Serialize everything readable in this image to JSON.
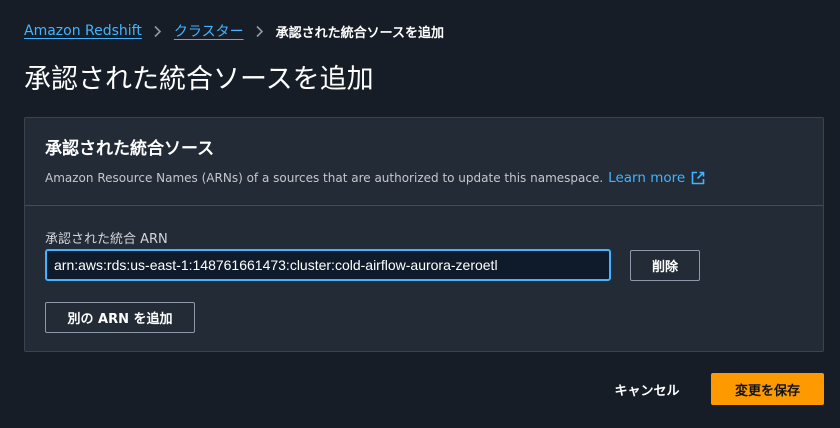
{
  "breadcrumb": {
    "items": [
      {
        "label": "Amazon Redshift"
      },
      {
        "label": "クラスター"
      },
      {
        "label": "承認された統合ソースを追加"
      }
    ]
  },
  "page": {
    "title": "承認された統合ソースを追加"
  },
  "panel": {
    "title": "承認された統合ソース",
    "description": "Amazon Resource Names (ARNs) of a sources that are authorized to update this namespace.",
    "learn_more": "Learn more",
    "field_label": "承認された統合 ARN",
    "arn_value": "arn:aws:rds:us-east-1:148761661473:cluster:cold-airflow-aurora-zeroetl",
    "remove_label": "削除",
    "add_arn_label": "別の ARN を追加"
  },
  "footer": {
    "cancel_label": "キャンセル",
    "save_label": "変更を保存"
  },
  "icons": {
    "breadcrumb_separator": "chevron-right-icon",
    "learn_more": "external-link-icon"
  },
  "colors": {
    "background": "#161d26",
    "panel": "#232b37",
    "link": "#42b4ff",
    "primary_button": "#ff9900"
  }
}
